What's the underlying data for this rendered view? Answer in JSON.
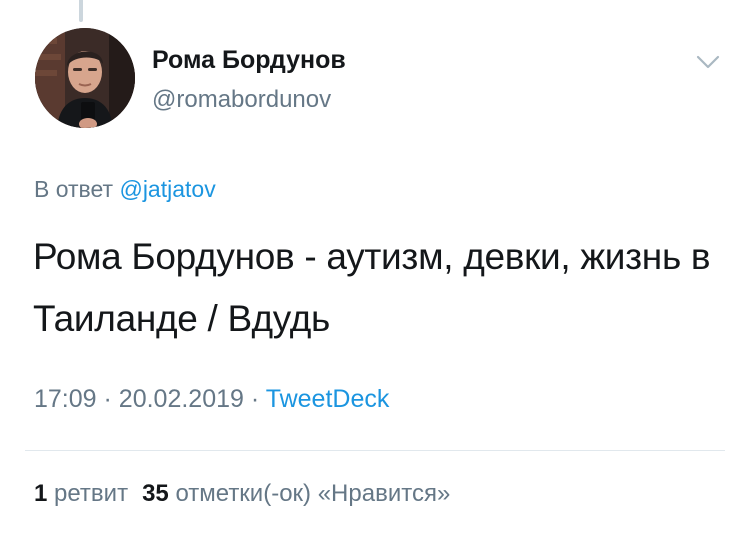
{
  "tweet": {
    "author": {
      "display_name": "Рома Бордунов",
      "handle": "@romabordunov"
    },
    "reply": {
      "prefix": "В ответ",
      "mention": "@jatjatov"
    },
    "text": "Рома Бордунов - аутизм, девки, жизнь в Таиланде / Вдудь",
    "time": "17:09",
    "separator": "·",
    "date": "20.02.2019",
    "source": "TweetDeck",
    "stats": {
      "retweets_count": "1",
      "retweets_label": "ретвит",
      "likes_count": "35",
      "likes_label": "отметки(-ок) «Нравится»"
    }
  },
  "icons": {
    "menu": "chevron-down-icon",
    "avatar": "avatar"
  },
  "colors": {
    "link": "#1b95e0",
    "secondary_text": "#657786",
    "primary_text": "#14171a",
    "divider": "#e1e8ed"
  }
}
